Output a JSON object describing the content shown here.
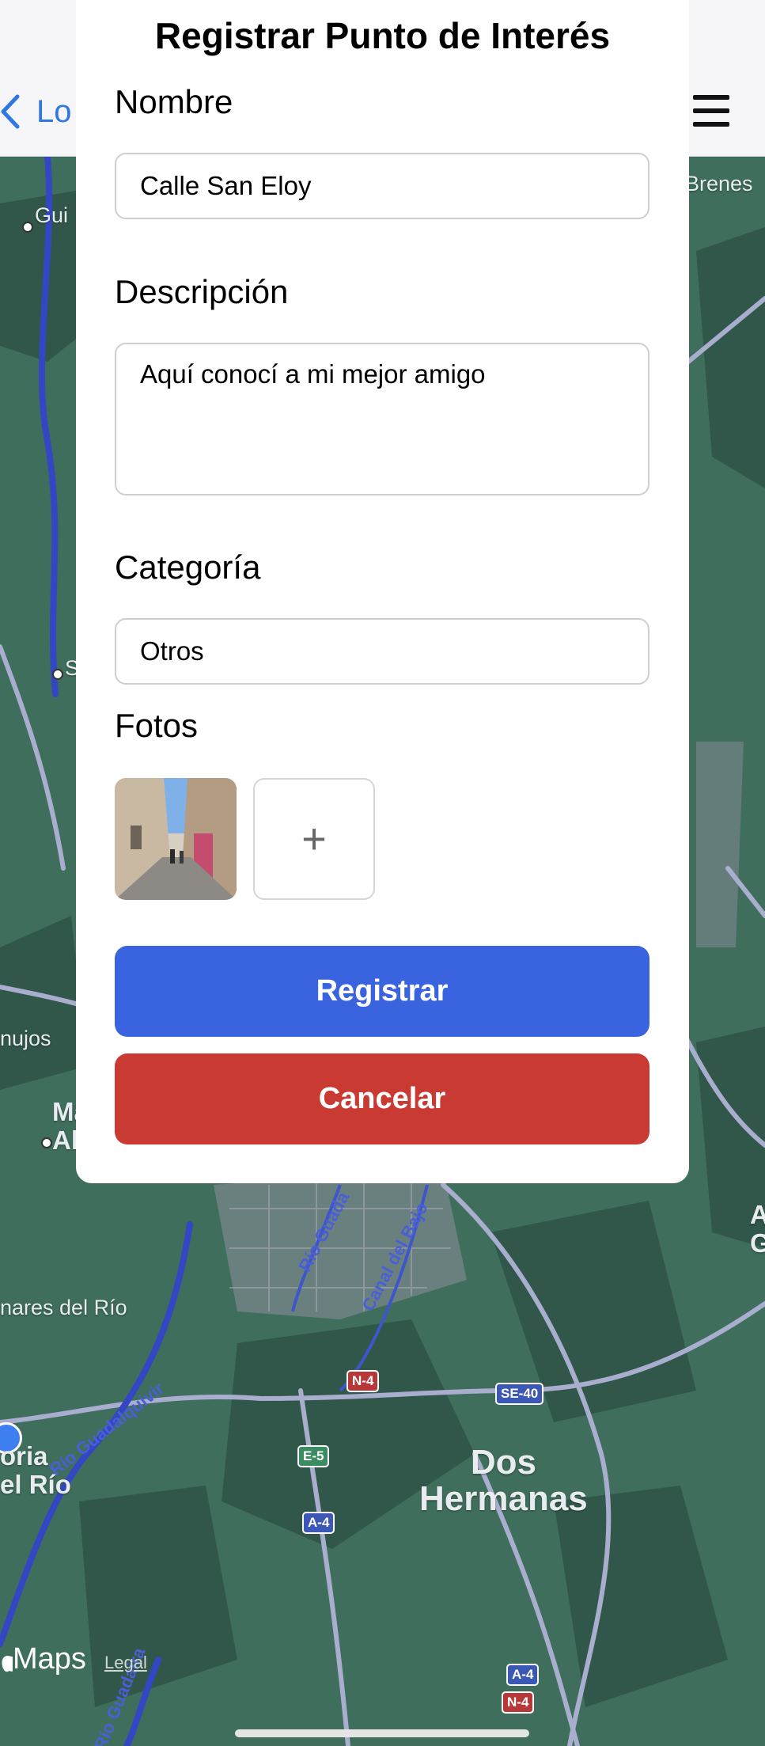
{
  "header": {
    "back_label": "Lo",
    "menu_icon": "hamburger-menu-icon"
  },
  "modal": {
    "title": "Registrar Punto de Interés",
    "name": {
      "label": "Nombre",
      "value": "Calle San Eloy"
    },
    "description": {
      "label": "Descripción",
      "value": "Aquí conocí a mi mejor amigo"
    },
    "category": {
      "label": "Categoría",
      "value": "Otros"
    },
    "photos": {
      "label": "Fotos",
      "add_label": "+"
    },
    "submit_label": "Registrar",
    "cancel_label": "Cancelar"
  },
  "map": {
    "labels": {
      "guillena": "Gui",
      "brenes": "Brenes",
      "s_town": "S",
      "nujos": "nujos",
      "ma_al": "Ma\nAl",
      "mares_del_rio": "nares del Río",
      "coria": "oria\nel Río",
      "dos_hermanas": "Dos\nHermanas",
      "a_g": "A\nG"
    },
    "rivers": {
      "guadalquivir": "Río Guadalquivir",
      "guadaira": "Río Guadaira",
      "guada_city": "Río Guada",
      "canal": "Canal del Bajo"
    },
    "roads": [
      "N-4",
      "SE-40",
      "E-5",
      "A-4",
      "A-4",
      "N-4"
    ],
    "brand": "Maps",
    "legal": "Legal"
  },
  "colors": {
    "primary": "#3a63e0",
    "danger": "#c93a33",
    "map_green": "#3f6e5c",
    "link_blue": "#2f78e4"
  }
}
